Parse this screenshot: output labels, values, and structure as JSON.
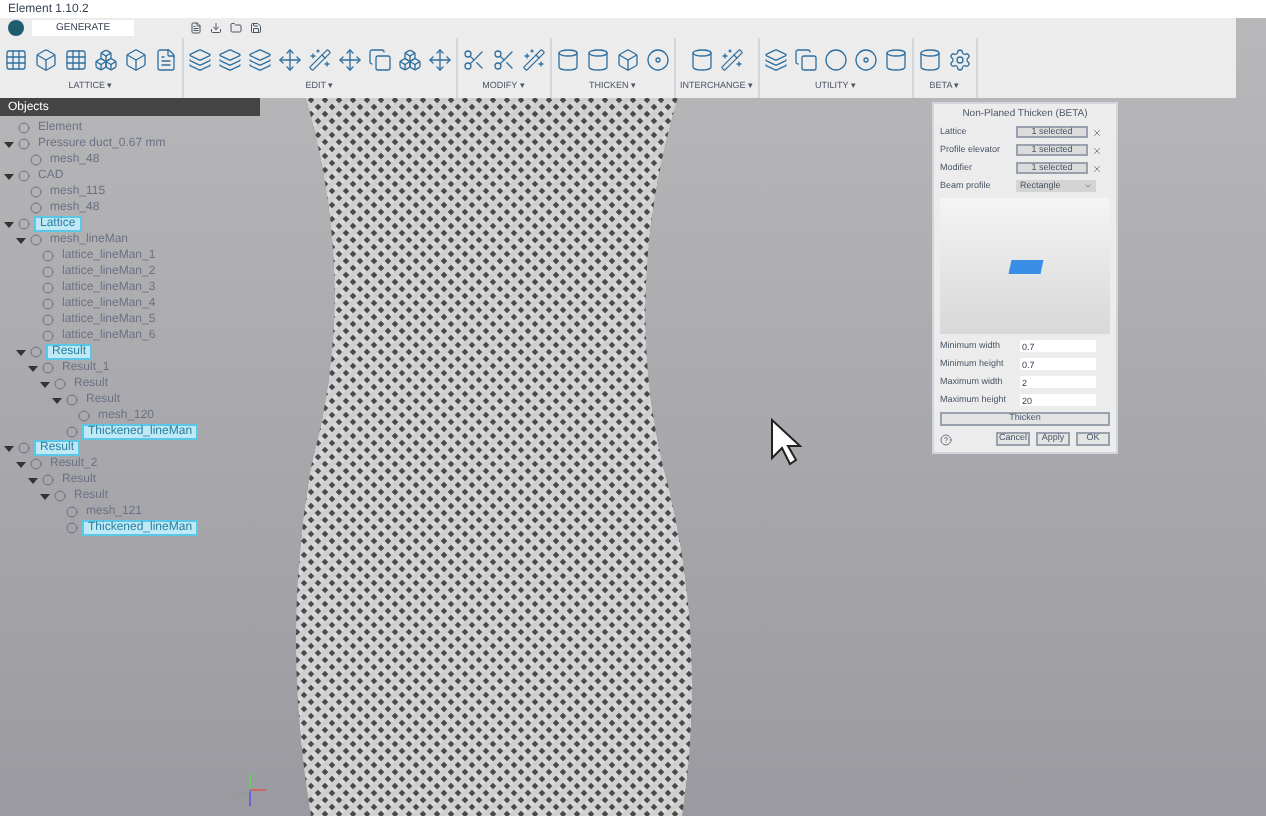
{
  "window": {
    "title": "Element 1.10.2"
  },
  "tabs": [
    {
      "label": "GENERATE",
      "selected": true
    }
  ],
  "ribbon_groups": [
    {
      "label": "LATTICE ▾"
    },
    {
      "label": "EDIT ▾"
    },
    {
      "label": "MODIFY ▾"
    },
    {
      "label": "THICKEN ▾"
    },
    {
      "label": "INTERCHANGE ▾"
    },
    {
      "label": "UTILITY ▾"
    },
    {
      "label": "BETA ▾"
    }
  ],
  "objects_panel": {
    "title": "Objects",
    "tree": [
      {
        "label": "Element",
        "selected": false
      },
      {
        "label": "Pressure duct_0.67 mm",
        "selected": false,
        "children": [
          {
            "label": "mesh_48",
            "selected": false
          }
        ]
      },
      {
        "label": "CAD",
        "selected": false,
        "children": [
          {
            "label": "mesh_115",
            "selected": false
          },
          {
            "label": "mesh_48",
            "selected": false
          }
        ]
      },
      {
        "label": "Lattice",
        "selected": true,
        "children": [
          {
            "label": "mesh_lineMan",
            "selected": false,
            "children": [
              {
                "label": "lattice_lineMan_1",
                "selected": false
              },
              {
                "label": "lattice_lineMan_2",
                "selected": false
              },
              {
                "label": "lattice_lineMan_3",
                "selected": false
              },
              {
                "label": "lattice_lineMan_4",
                "selected": false
              },
              {
                "label": "lattice_lineMan_5",
                "selected": false
              },
              {
                "label": "lattice_lineMan_6",
                "selected": false
              }
            ]
          },
          {
            "label": "Result",
            "selected": true,
            "children": [
              {
                "label": "Result_1",
                "selected": false,
                "children": [
                  {
                    "label": "Result",
                    "selected": false,
                    "children": [
                      {
                        "label": "Result",
                        "selected": false,
                        "children": [
                          {
                            "label": "mesh_120",
                            "selected": false
                          }
                        ]
                      },
                      {
                        "label": "Thickened_lineMan",
                        "selected": true
                      }
                    ]
                  }
                ]
              }
            ]
          }
        ]
      },
      {
        "label": "Result",
        "selected": true,
        "children": [
          {
            "label": "Result_2",
            "selected": false,
            "children": [
              {
                "label": "Result",
                "selected": false,
                "children": [
                  {
                    "label": "Result",
                    "selected": false,
                    "children": [
                      {
                        "label": "mesh_121",
                        "selected": false
                      },
                      {
                        "label": "Thickened_lineMan",
                        "selected": true
                      }
                    ]
                  }
                ]
              }
            ]
          }
        ]
      }
    ]
  },
  "dialog": {
    "title": "Non-Planed Thicken (BETA)",
    "selectors": [
      {
        "label": "Lattice",
        "value": "1 selected",
        "kind": "pick"
      },
      {
        "label": "Profile elevator",
        "value": "1 selected",
        "kind": "pick"
      },
      {
        "label": "Modifier",
        "value": "1 selected",
        "kind": "pick"
      },
      {
        "label": "Beam profile",
        "value": "Rectangle",
        "kind": "dropdown"
      }
    ],
    "fields": [
      {
        "label": "Minimum width",
        "value": "0.7"
      },
      {
        "label": "Minimum height",
        "value": "0.7"
      },
      {
        "label": "Maximum width",
        "value": "2"
      },
      {
        "label": "Maximum height",
        "value": "20"
      }
    ],
    "action": "Thicken",
    "buttons": [
      "Cancel",
      "Apply",
      "OK"
    ]
  }
}
